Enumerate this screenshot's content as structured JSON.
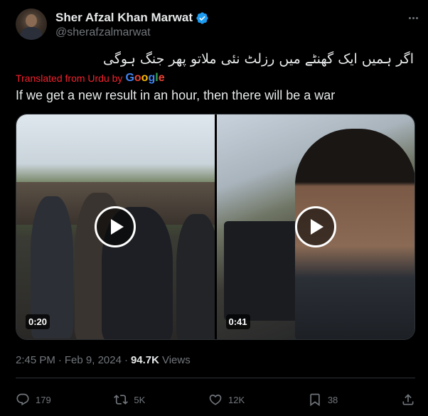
{
  "author": {
    "display_name": "Sher Afzal Khan Marwat",
    "handle": "@sherafzalmarwat",
    "verified": true
  },
  "post": {
    "original_text": "اگر ہمیں ایک گھنٹے میں رزلٹ نئی ملاتو پھر جنگ ہوگی",
    "translated_from": "Translated from Urdu by",
    "translator": "Google",
    "translation": "If we get a new result in an hour, then there will be a war"
  },
  "media": [
    {
      "type": "video",
      "duration": "0:20"
    },
    {
      "type": "video",
      "duration": "0:41"
    }
  ],
  "meta": {
    "time": "2:45 PM",
    "separator": "·",
    "date": "Feb 9, 2024",
    "separator2": "·",
    "views_count": "94.7K",
    "views_label": "Views"
  },
  "actions": {
    "replies": "179",
    "reposts": "5K",
    "likes": "12K",
    "bookmarks": "38"
  },
  "icons": {
    "more": "more-horizontal-icon",
    "reply": "reply-icon",
    "repost": "repost-icon",
    "like": "like-icon",
    "bookmark": "bookmark-icon",
    "share": "share-icon",
    "verified": "verified-badge-icon"
  },
  "colors": {
    "background": "#000000",
    "text": "#e7e9ea",
    "muted": "#71767b",
    "verified": "#1d9bf0",
    "translated": "#f4212e"
  }
}
